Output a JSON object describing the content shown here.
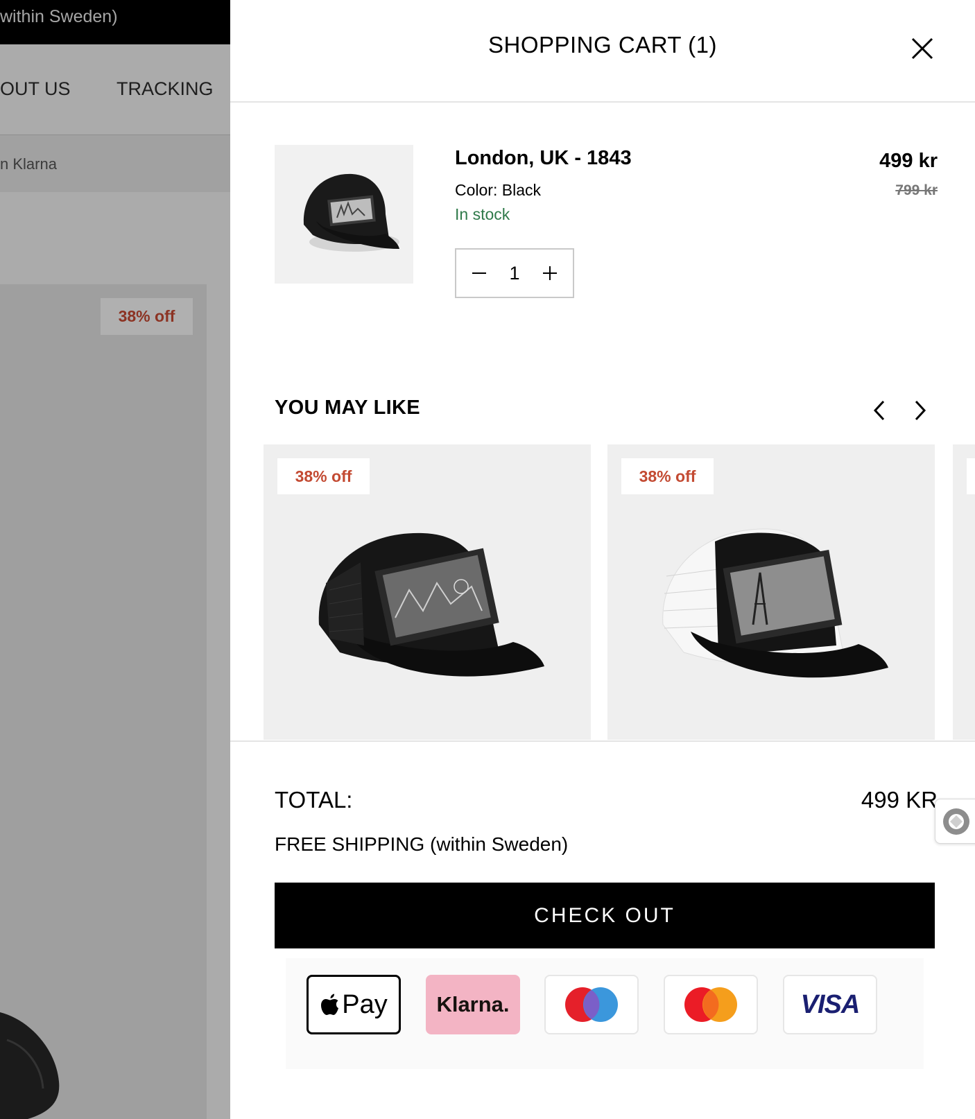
{
  "background_page": {
    "topbar_text": "within Sweden)",
    "nav": [
      "OUT US",
      "TRACKING"
    ],
    "klarna_text": "n Klarna",
    "badge": "38% off"
  },
  "cart": {
    "title": "SHOPPING CART (1)",
    "close_icon": "close-icon",
    "item": {
      "name": "London, UK - 1843",
      "color": "Color: Black",
      "stock": "In stock",
      "price": "499 kr",
      "old_price": "799 kr",
      "quantity": "1"
    },
    "you_may_like": {
      "title": "YOU MAY LIKE",
      "products": [
        {
          "badge": "38% off"
        },
        {
          "badge": "38% off"
        }
      ]
    },
    "total_label": "TOTAL:",
    "total_value": "499 KR",
    "shipping": "FREE SHIPPING (within Sweden)",
    "checkout_label": "CHECK OUT",
    "payment_methods": {
      "apple_pay": "Pay",
      "klarna": "Klarna.",
      "maestro": "maestro-logo",
      "mastercard": "mastercard-logo",
      "visa": "VISA"
    }
  },
  "colors": {
    "accent_red": "#c34a32",
    "stock_green": "#2f7a4a",
    "klarna_pink": "#f3b4c4"
  }
}
